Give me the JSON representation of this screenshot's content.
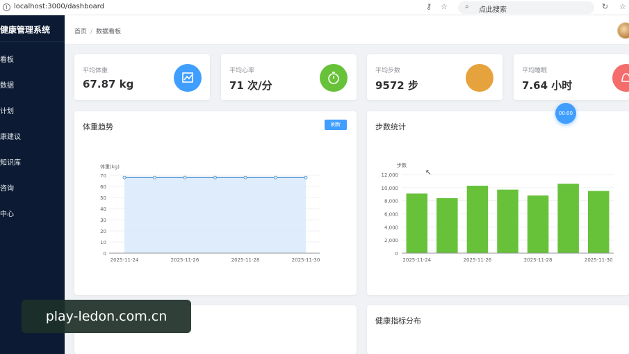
{
  "browser": {
    "url": "localhost:3000/dashboard",
    "search_placeholder": "点此搜索"
  },
  "sidebar": {
    "title": "健康管理系统",
    "items": [
      {
        "label": "看板"
      },
      {
        "label": "数据"
      },
      {
        "label": "计划"
      },
      {
        "label": "康建议"
      },
      {
        "label": "知识库"
      },
      {
        "label": "咨询"
      },
      {
        "label": "中心"
      }
    ]
  },
  "header": {
    "breadcrumb": [
      "首页",
      "数据看板"
    ]
  },
  "stats": [
    {
      "label": "平均体重",
      "value": "67.87 kg",
      "icon": "trend-chart-icon",
      "color": "#409eff"
    },
    {
      "label": "平均心率",
      "value": "71 次/分",
      "icon": "stopwatch-icon",
      "color": "#67c23a"
    },
    {
      "label": "平均步数",
      "value": "9572 步",
      "icon": "footprint-icon",
      "color": "#e6a23c"
    },
    {
      "label": "平均睡眠",
      "value": "7.64 小时",
      "icon": "bell-icon",
      "color": "#f56c6c"
    }
  ],
  "weight_panel": {
    "title": "体重趋势",
    "refresh_label": "刷新"
  },
  "steps_panel": {
    "title": "步数统计"
  },
  "bottom_right_panel": {
    "title": "健康指标分布"
  },
  "float_badge": "00:00",
  "watermark": "play-ledon.com.cn",
  "chart_data": [
    {
      "type": "area",
      "ylabel": "体重(kg)",
      "x": [
        "2025-11-24",
        "2025-11-25",
        "2025-11-26",
        "2025-11-27",
        "2025-11-28",
        "2025-11-29",
        "2025-11-30"
      ],
      "xtick_labels": [
        "2025-11-24",
        "2025-11-26",
        "2025-11-28",
        "2025-11-30"
      ],
      "values": [
        68,
        68,
        68,
        68,
        68,
        68,
        68
      ],
      "ylim": [
        0,
        70
      ],
      "yticks": [
        0,
        10,
        20,
        30,
        40,
        50,
        60,
        70
      ],
      "color": "#5b9bd5"
    },
    {
      "type": "bar",
      "ylabel": "步数",
      "x": [
        "2025-11-24",
        "2025-11-25",
        "2025-11-26",
        "2025-11-27",
        "2025-11-28",
        "2025-11-29",
        "2025-11-30"
      ],
      "xtick_labels": [
        "2025-11-24",
        "2025-11-26",
        "2025-11-28",
        "2025-11-30"
      ],
      "values": [
        9100,
        8400,
        10300,
        9700,
        8800,
        10600,
        9500
      ],
      "ylim": [
        0,
        12000
      ],
      "yticks": [
        "0",
        "2,000",
        "4,000",
        "6,000",
        "8,000",
        "10,000",
        "12,000"
      ],
      "color": "#67c23a"
    }
  ]
}
